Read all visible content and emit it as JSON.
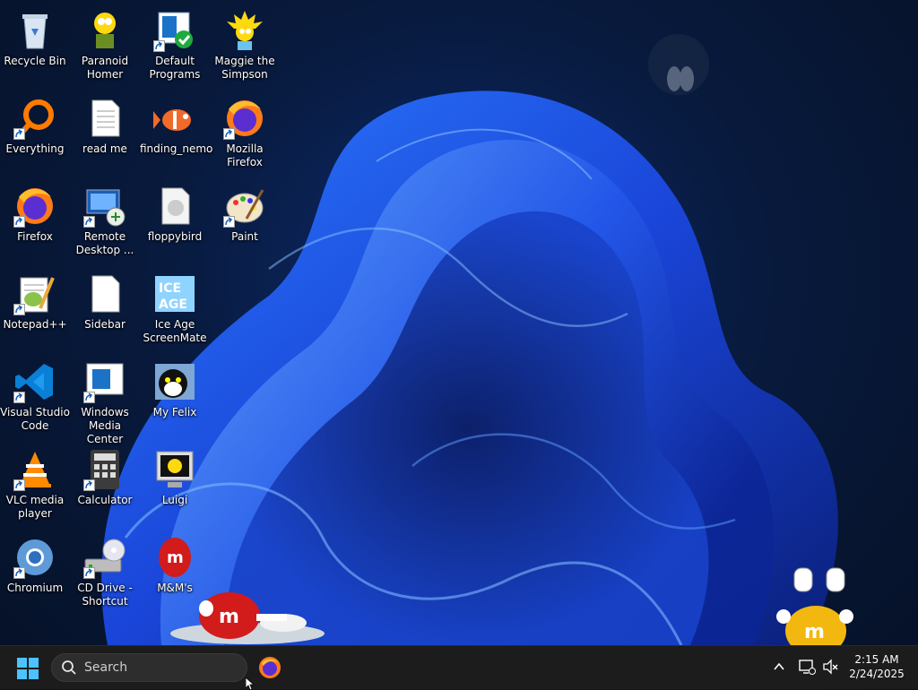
{
  "desktop": {
    "icons": [
      {
        "label": "Recycle Bin",
        "icon": "recycle-bin-icon",
        "shortcut": false
      },
      {
        "label": "Paranoid Homer",
        "icon": "homer-icon",
        "shortcut": false
      },
      {
        "label": "Default Programs",
        "icon": "default-programs-icon",
        "shortcut": true
      },
      {
        "label": "Maggie the Simpson",
        "icon": "maggie-icon",
        "shortcut": false
      },
      {
        "label": "Everything",
        "icon": "everything-search-icon",
        "shortcut": true
      },
      {
        "label": "read me",
        "icon": "text-file-icon",
        "shortcut": false
      },
      {
        "label": "finding_nemo",
        "icon": "nemo-fish-icon",
        "shortcut": false
      },
      {
        "label": "Mozilla Firefox",
        "icon": "firefox-icon",
        "shortcut": true
      },
      {
        "label": "Firefox",
        "icon": "firefox-icon",
        "shortcut": true
      },
      {
        "label": "Remote Desktop ...",
        "icon": "remote-desktop-icon",
        "shortcut": true
      },
      {
        "label": "floppybird",
        "icon": "generic-file-icon",
        "shortcut": false
      },
      {
        "label": "Paint",
        "icon": "paint-palette-icon",
        "shortcut": true
      },
      {
        "label": "Notepad++",
        "icon": "notepadpp-icon",
        "shortcut": true
      },
      {
        "label": "Sidebar",
        "icon": "blank-file-icon",
        "shortcut": false
      },
      {
        "label": "Ice Age ScreenMate",
        "icon": "ice-age-icon",
        "shortcut": false
      },
      {
        "label": "Visual Studio Code",
        "icon": "vscode-icon",
        "shortcut": true
      },
      {
        "label": "Windows Media Center",
        "icon": "media-center-icon",
        "shortcut": true
      },
      {
        "label": "My Felix",
        "icon": "felix-cat-icon",
        "shortcut": false
      },
      {
        "label": "VLC media player",
        "icon": "vlc-cone-icon",
        "shortcut": true
      },
      {
        "label": "Calculator",
        "icon": "calculator-icon",
        "shortcut": true
      },
      {
        "label": "Luigi",
        "icon": "luigi-monitor-icon",
        "shortcut": false
      },
      {
        "label": "Chromium",
        "icon": "chromium-icon",
        "shortcut": true
      },
      {
        "label": "CD Drive - Shortcut",
        "icon": "cd-drive-icon",
        "shortcut": true
      },
      {
        "label": "M&M's",
        "icon": "mms-icon",
        "shortcut": false
      }
    ]
  },
  "taskbar": {
    "search_placeholder": "Search",
    "start_icon": "windows-start-icon",
    "pinned_app": "firefox-icon",
    "tray_icons": [
      "chevron-up-icon",
      "network-icon",
      "volume-muted-icon"
    ],
    "clock": {
      "time": "2:15 AM",
      "date": "2/24/2025"
    }
  },
  "colors": {
    "wallpaper_blue": "#1f4fe0",
    "taskbar_bg": "#1c1c1c",
    "accent": "#0078d4"
  }
}
